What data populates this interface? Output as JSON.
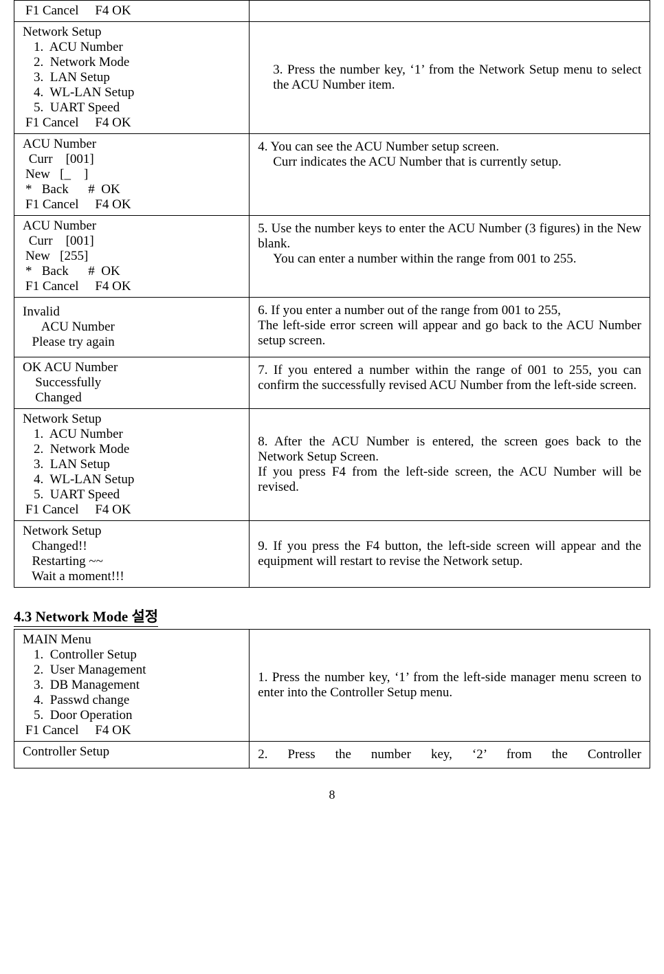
{
  "rows1": [
    {
      "left": [
        {
          "cls": "menu-footer",
          "text": "F1 Cancel     F4 OK"
        }
      ],
      "right": [
        {
          "text": ""
        }
      ]
    },
    {
      "left": [
        {
          "cls": "menu-title",
          "text": "Network Setup"
        },
        {
          "cls": "menu-item",
          "text": "1.  ACU Number"
        },
        {
          "cls": "menu-item",
          "text": "2.  Network Mode"
        },
        {
          "cls": "menu-item",
          "text": "3.  LAN Setup"
        },
        {
          "cls": "menu-item",
          "text": "4.  WL-LAN Setup"
        },
        {
          "cls": "menu-item",
          "text": "5.  UART Speed"
        },
        {
          "cls": "menu-footer",
          "text": "F1 Cancel     F4 OK"
        }
      ],
      "right": [
        {
          "cls": "indent-block",
          "text": "3. Press the number key, ‘1’ from the Network Setup menu to select the ACU Number item."
        }
      ],
      "rightCenter": true
    },
    {
      "left": [
        {
          "cls": "menu-title",
          "text": "ACU Number"
        },
        {
          "text": " "
        },
        {
          "cls": "screen-line",
          "text": " Curr    [001]"
        },
        {
          "cls": "screen-line",
          "text": "New   [_    ]"
        },
        {
          "cls": "screen-line",
          "text": "*   Back      #  OK"
        },
        {
          "cls": "menu-footer",
          "text": "F1 Cancel     F4 OK"
        }
      ],
      "right": [
        {
          "text": "4. You can see the ACU Number setup screen."
        },
        {
          "cls": "indent-block",
          "text": "Curr indicates the ACU Number that is currently setup."
        }
      ]
    },
    {
      "left": [
        {
          "cls": "menu-title",
          "text": "ACU Number"
        },
        {
          "text": " "
        },
        {
          "cls": "screen-line",
          "text": " Curr    [001]"
        },
        {
          "cls": "screen-line",
          "text": "New   [255]"
        },
        {
          "cls": "screen-line",
          "text": "*   Back      #  OK"
        },
        {
          "cls": "menu-footer",
          "text": "F1 Cancel     F4 OK"
        }
      ],
      "right": [
        {
          "text": "5. Use the number keys to enter the ACU Number (3 figures) in the New blank."
        },
        {
          "cls": "indent-block",
          "text": "You can enter a number within the range from 001 to 255."
        }
      ]
    },
    {
      "left": [
        {
          "cls": "spacer",
          "text": ""
        },
        {
          "cls": "menu-title",
          "text": "Invalid"
        },
        {
          "cls": "screen-line",
          "text": "     ACU Number"
        },
        {
          "text": " "
        },
        {
          "cls": "screen-line",
          "text": "  Please try again"
        },
        {
          "cls": "spacer",
          "text": ""
        }
      ],
      "right": [
        {
          "text": "6. If you enter a number out of the range from 001 to 255,"
        },
        {
          "text": "   The left-side error screen will appear and go back to the ACU Number setup screen."
        }
      ]
    },
    {
      "left": [
        {
          "cls": "menu-title",
          "text": "OK  ACU  Number"
        },
        {
          "cls": "screen-line",
          "text": "   Successfully"
        },
        {
          "cls": "screen-line",
          "text": "   Changed"
        },
        {
          "text": " "
        }
      ],
      "right": [
        {
          "text": "7. If you entered a number within the range of 001 to 255, you can confirm the successfully revised ACU Number from the left-side screen."
        }
      ]
    },
    {
      "left": [
        {
          "cls": "menu-title",
          "text": "Network Setup"
        },
        {
          "cls": "menu-item",
          "text": "1.  ACU Number"
        },
        {
          "cls": "menu-item",
          "text": "2.  Network Mode"
        },
        {
          "cls": "menu-item",
          "text": "3.  LAN Setup"
        },
        {
          "cls": "menu-item",
          "text": "4.  WL-LAN Setup"
        },
        {
          "cls": "menu-item",
          "text": "5.  UART Speed"
        },
        {
          "cls": "menu-footer",
          "text": "F1 Cancel     F4 OK"
        }
      ],
      "right": [
        {
          "text": "8. After the ACU Number is entered, the screen goes back to the Network Setup Screen."
        },
        {
          "text": "   If you press F4 from the left-side screen, the ACU Number will be revised."
        }
      ],
      "rightCenter": true
    },
    {
      "left": [
        {
          "cls": "menu-title",
          "text": "Network Setup"
        },
        {
          "cls": "screen-line",
          "text": "  Changed!!"
        },
        {
          "text": " "
        },
        {
          "cls": "screen-line",
          "text": "  Restarting ~~"
        },
        {
          "cls": "screen-line",
          "text": "  Wait a moment!!!"
        }
      ],
      "right": [
        {
          "text": "9. If you press the F4 button, the left-side screen will appear and the equipment will restart to revise the Network setup."
        }
      ],
      "rightCenter": true
    }
  ],
  "sectionHeading": "4.3 Network Mode 설정",
  "rows2": [
    {
      "left": [
        {
          "cls": "menu-title",
          "text": "MAIN Menu"
        },
        {
          "cls": "menu-item",
          "text": "1.  Controller Setup"
        },
        {
          "cls": "menu-item",
          "text": "2.  User Management"
        },
        {
          "cls": "menu-item",
          "text": "3.  DB Management"
        },
        {
          "cls": "menu-item",
          "text": "4.  Passwd change"
        },
        {
          "cls": "menu-item",
          "text": "5.  Door Operation"
        },
        {
          "cls": "menu-footer",
          "text": "F1 Cancel     F4 OK"
        }
      ],
      "right": [
        {
          "text": "1. Press the number key, ‘1’ from the left-side manager menu screen to enter into the Controller Setup menu."
        }
      ],
      "rightCenter": true
    },
    {
      "left": [
        {
          "cls": "menu-title",
          "text": "Controller Setup"
        }
      ],
      "right": [
        {
          "text": "2. Press the number key, ‘2’ from the Controller"
        }
      ],
      "rightJustifyBoth": true
    }
  ],
  "pageNumber": "8"
}
